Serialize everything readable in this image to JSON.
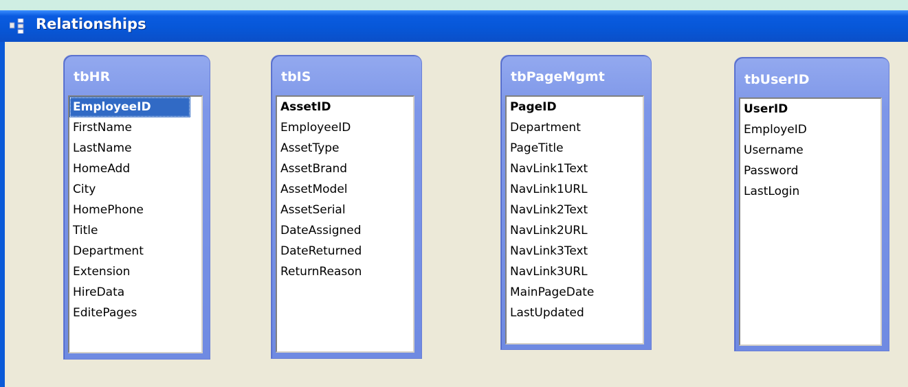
{
  "window": {
    "title": "Relationships",
    "icon": "relationships-icon",
    "titlebar_color": "#0757d8"
  },
  "tables": [
    {
      "name": "tbHR",
      "fields": [
        {
          "label": "EmployeeID",
          "key": true,
          "selected": true
        },
        {
          "label": "FirstName"
        },
        {
          "label": "LastName"
        },
        {
          "label": "HomeAdd"
        },
        {
          "label": "City"
        },
        {
          "label": "HomePhone"
        },
        {
          "label": "Title"
        },
        {
          "label": "Department"
        },
        {
          "label": "Extension"
        },
        {
          "label": "HireData"
        },
        {
          "label": "EditePages"
        }
      ]
    },
    {
      "name": "tbIS",
      "fields": [
        {
          "label": "AssetID",
          "key": true
        },
        {
          "label": "EmployeeID"
        },
        {
          "label": "AssetType"
        },
        {
          "label": "AssetBrand"
        },
        {
          "label": "AssetModel"
        },
        {
          "label": "AssetSerial"
        },
        {
          "label": "DateAssigned"
        },
        {
          "label": "DateReturned"
        },
        {
          "label": "ReturnReason"
        }
      ]
    },
    {
      "name": "tbPageMgmt",
      "fields": [
        {
          "label": "PageID",
          "key": true
        },
        {
          "label": "Department"
        },
        {
          "label": "PageTitle"
        },
        {
          "label": "NavLink1Text"
        },
        {
          "label": "NavLink1URL"
        },
        {
          "label": "NavLink2Text"
        },
        {
          "label": "NavLink2URL"
        },
        {
          "label": "NavLink3Text"
        },
        {
          "label": "NavLink3URL"
        },
        {
          "label": "MainPageDate"
        },
        {
          "label": "LastUpdated"
        }
      ]
    },
    {
      "name": "tbUserID",
      "fields": [
        {
          "label": "UserID",
          "key": true
        },
        {
          "label": "EmployeID"
        },
        {
          "label": "Username"
        },
        {
          "label": "Password"
        },
        {
          "label": "LastLogin"
        }
      ]
    }
  ]
}
